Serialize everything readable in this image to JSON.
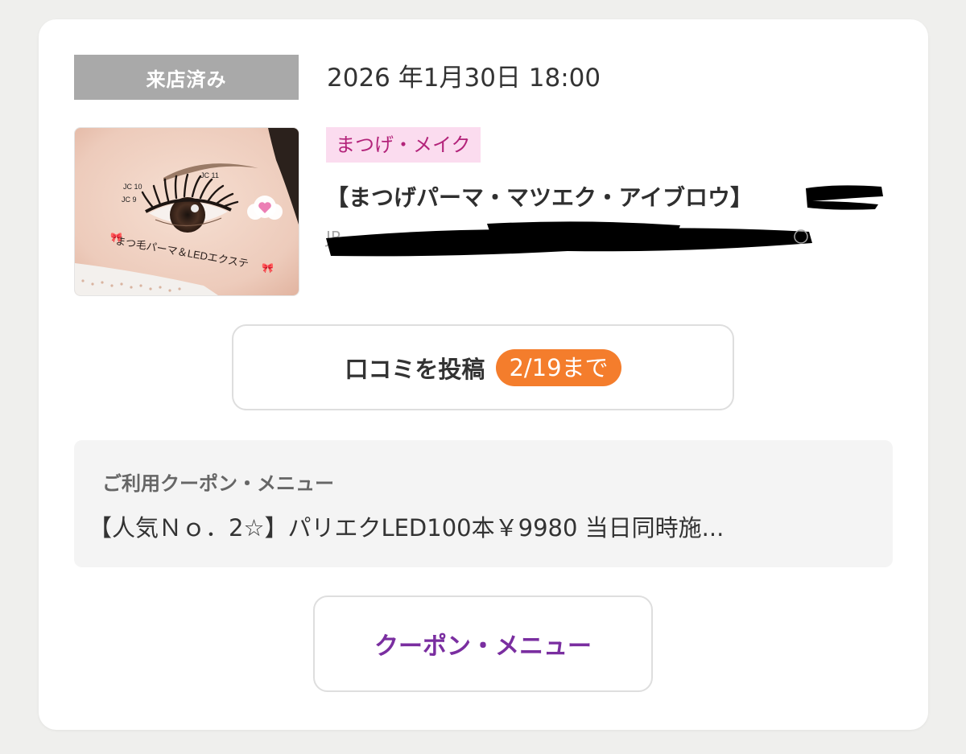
{
  "reservation": {
    "status": "来店済み",
    "datetime": "2026 年1月30日 18:00"
  },
  "salon": {
    "category": "まつげ・メイク",
    "name": "【まつげパーマ・マツエク・アイブロウ】",
    "sub_text": "JR",
    "thumbnail_caption": "まつ毛パーマ＆LEDエクステ",
    "thumbnail_labels": [
      "JC 10",
      "JC 9",
      "JC 11"
    ]
  },
  "review_button": {
    "label": "口コミを投稿",
    "deadline": "2/19まで"
  },
  "coupon": {
    "heading": "ご利用クーポン・メニュー",
    "text": "【人気Ｎｏ．2☆】パリエクLED100本￥9980 当日同時施..."
  },
  "coupon_menu_button": {
    "label": "クーポン・メニュー"
  },
  "colors": {
    "status_badge": "#a9a9a9",
    "category_bg": "#fbdcef",
    "category_text": "#b3237a",
    "deadline_badge": "#f47d2c",
    "coupon_menu_text": "#7a2ea0"
  }
}
